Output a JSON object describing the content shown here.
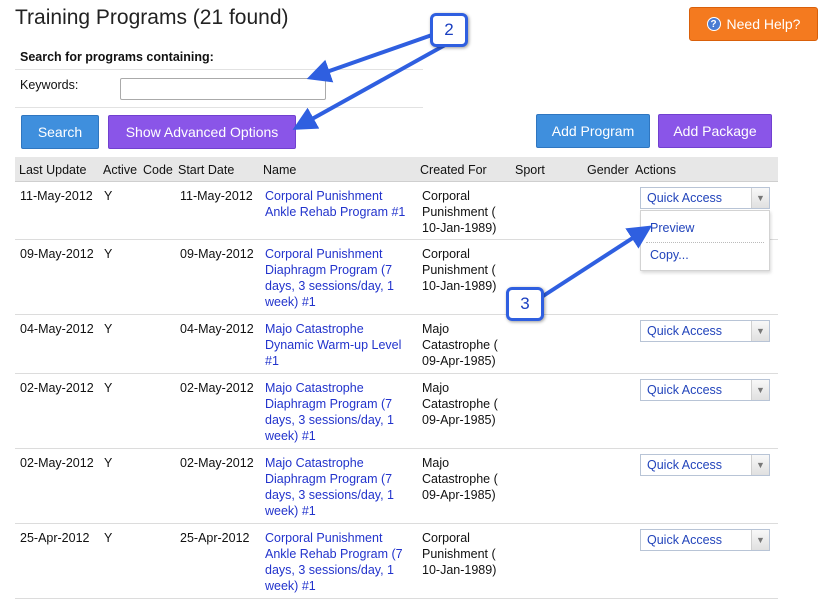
{
  "page": {
    "title": "Training Programs (21 found)",
    "help_label": "Need Help?",
    "search_heading": "Search for programs containing:",
    "keywords_label": "Keywords:",
    "keywords_value": "",
    "search_label": "Search",
    "advanced_label": "Show Advanced Options",
    "add_program_label": "Add Program",
    "add_package_label": "Add Package"
  },
  "table": {
    "headers": [
      "Last Update",
      "Active",
      "Code",
      "Start Date",
      "Name",
      "Created For",
      "Sport",
      "Gender",
      "Actions"
    ],
    "rows": [
      {
        "last_update": "11-May-2012",
        "active": "Y",
        "start_date": "11-May-2012",
        "name": [
          "Corporal Punishment",
          "Ankle Rehab Program #1"
        ],
        "created_for": [
          "Corporal",
          "Punishment (",
          "10-Jan-1989)"
        ],
        "action": "Quick Access"
      },
      {
        "last_update": "09-May-2012",
        "active": "Y",
        "start_date": "09-May-2012",
        "name": [
          "Corporal Punishment",
          "Diaphragm Program (7",
          "days, 3 sessions/day, 1",
          "week) #1"
        ],
        "created_for": [
          "Corporal",
          "Punishment (",
          "10-Jan-1989)"
        ],
        "action": ""
      },
      {
        "last_update": "04-May-2012",
        "active": "Y",
        "start_date": "04-May-2012",
        "name": [
          "Majo Catastrophe",
          "Dynamic Warm-up Level",
          "#1"
        ],
        "created_for": [
          "Majo",
          "Catastrophe (",
          "09-Apr-1985)"
        ],
        "action": "Quick Access"
      },
      {
        "last_update": "02-May-2012",
        "active": "Y",
        "start_date": "02-May-2012",
        "name": [
          "Majo Catastrophe",
          "Diaphragm Program (7",
          "days, 3 sessions/day, 1",
          "week) #1"
        ],
        "created_for": [
          "Majo",
          "Catastrophe (",
          "09-Apr-1985)"
        ],
        "action": "Quick Access"
      },
      {
        "last_update": "02-May-2012",
        "active": "Y",
        "start_date": "02-May-2012",
        "name": [
          "Majo Catastrophe",
          "Diaphragm Program (7",
          "days, 3 sessions/day, 1",
          "week) #1"
        ],
        "created_for": [
          "Majo",
          "Catastrophe (",
          "09-Apr-1985)"
        ],
        "action": "Quick Access"
      },
      {
        "last_update": "25-Apr-2012",
        "active": "Y",
        "start_date": "25-Apr-2012",
        "name": [
          "Corporal Punishment",
          "Ankle Rehab Program (7",
          "days, 3 sessions/day, 1",
          "week) #1"
        ],
        "created_for": [
          "Corporal",
          "Punishment (",
          "10-Jan-1989)"
        ],
        "action": "Quick Access"
      }
    ]
  },
  "quick_access_menu": {
    "items": [
      "Preview",
      "Copy..."
    ]
  },
  "callouts": [
    "2",
    "3"
  ],
  "colors": {
    "help": "#f47a1f",
    "blue_button": "#3f8fdd",
    "purple_button": "#8a55e8",
    "link": "#2233cc",
    "callout_border": "#2f5fe0"
  }
}
